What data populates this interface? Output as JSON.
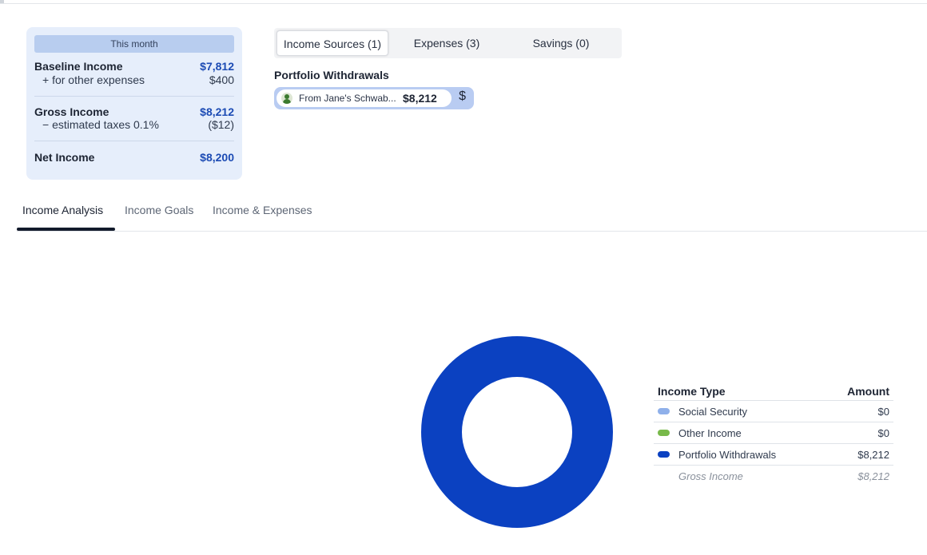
{
  "summary": {
    "header": "This month",
    "baseline_label": "Baseline Income",
    "baseline_value": "$7,812",
    "other_label": "+ for other expenses",
    "other_value": "$400",
    "gross_label": "Gross Income",
    "gross_value": "$8,212",
    "taxes_label": "− estimated taxes 0.1%",
    "taxes_value": "($12)",
    "net_label": "Net Income",
    "net_value": "$8,200"
  },
  "tabs": [
    {
      "label": "Income Sources (1)",
      "active": true
    },
    {
      "label": "Expenses (3)",
      "active": false
    },
    {
      "label": "Savings (0)",
      "active": false
    }
  ],
  "portfolio": {
    "title": "Portfolio Withdrawals",
    "source": "From Jane's Schwab...",
    "amount": "$8,212",
    "action_icon": "$"
  },
  "analysis_tabs": [
    {
      "label": "Income Analysis",
      "active": true
    },
    {
      "label": "Income Goals",
      "active": false
    },
    {
      "label": "Income & Expenses",
      "active": false
    }
  ],
  "legend": {
    "col_type": "Income Type",
    "col_amount": "Amount",
    "rows": [
      {
        "name": "Social Security",
        "amount": "$0",
        "color": "#8fb0ea"
      },
      {
        "name": "Other Income",
        "amount": "$0",
        "color": "#78b94a"
      },
      {
        "name": "Portfolio Withdrawals",
        "amount": "$8,212",
        "color": "#0b41c1"
      }
    ],
    "total_label": "Gross Income",
    "total_amount": "$8,212"
  },
  "chart_data": {
    "type": "pie",
    "style": "donut",
    "categories": [
      "Social Security",
      "Other Income",
      "Portfolio Withdrawals"
    ],
    "values": [
      0,
      0,
      8212
    ],
    "colors": [
      "#8fb0ea",
      "#78b94a",
      "#0b41c1"
    ]
  }
}
